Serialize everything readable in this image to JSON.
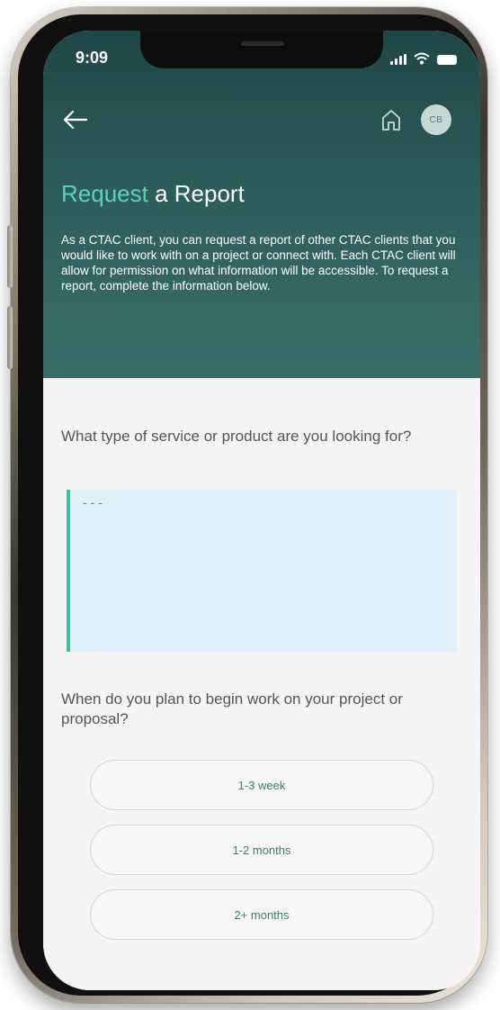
{
  "status_bar": {
    "time": "9:09"
  },
  "nav": {
    "back_icon": "arrow-left-icon",
    "home_icon": "home-icon",
    "avatar_initials": "CB"
  },
  "header": {
    "title_accent": "Request",
    "title_rest": "a Report",
    "intro": "As a CTAC client, you can request a report of other CTAC clients that you would like to work with on a project or connect with. Each CTAC client will allow for permission on what information will be accessible. To request a report, complete the information below."
  },
  "questions": {
    "service_question": "What type of service or product are you looking for?",
    "service_placeholder": "- - -",
    "timeline_question": "When do you plan to begin work on your project or proposal?"
  },
  "timeline_options": [
    {
      "label": "1-3 week"
    },
    {
      "label": "1-2 months"
    },
    {
      "label": "2+ months"
    }
  ],
  "colors": {
    "header_bg": "#2d5d5b",
    "accent": "#5fd0b8",
    "option_text": "#3f7c70",
    "answer_bg": "#dff0f8",
    "answer_border": "#3fbfa0"
  }
}
